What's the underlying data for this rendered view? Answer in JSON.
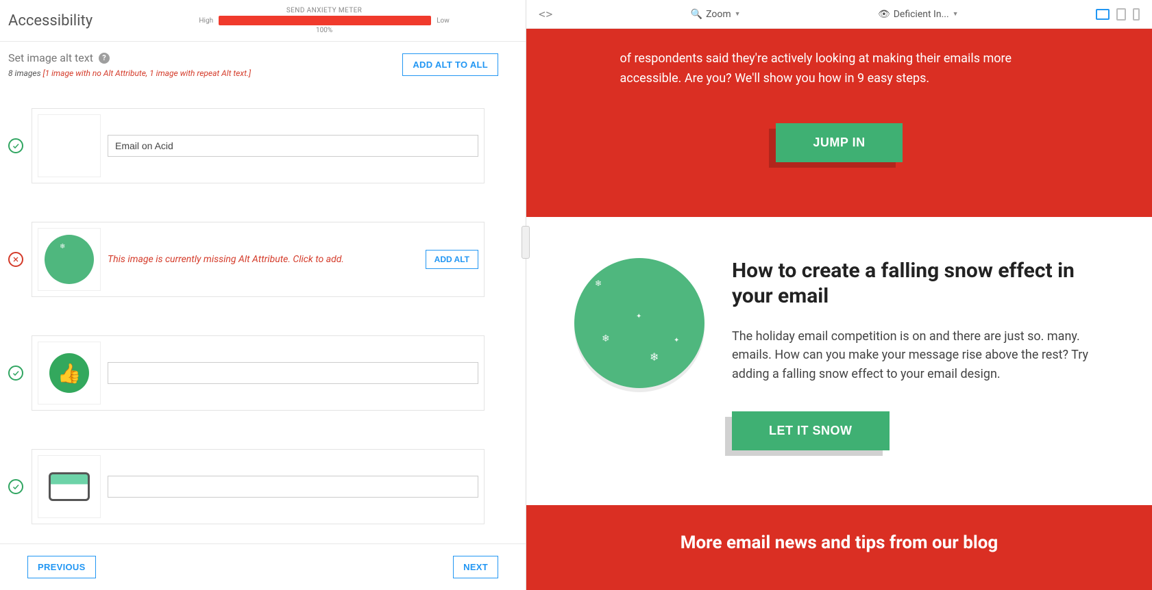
{
  "header": {
    "title": "Accessibility",
    "meter_label": "SEND ANXIETY METER",
    "meter_high": "High",
    "meter_low": "Low",
    "meter_pct": "100%"
  },
  "subhead": {
    "title": "Set image alt text",
    "count_text": "8 images",
    "warn_text": "[1 image with no Alt Attribute, 1 image with repeat Alt text.]",
    "add_all": "ADD ALT TO ALL"
  },
  "rows": {
    "r1_value": "Email on Acid",
    "r2_msg": "This image is currently missing Alt Attribute. Click to add.",
    "r2_btn": "ADD ALT",
    "r3_value": "",
    "r4_value": ""
  },
  "nav": {
    "prev": "PREVIOUS",
    "next": "NEXT"
  },
  "toolbar": {
    "zoom": "Zoom",
    "deficient": "Deficient In..."
  },
  "email": {
    "hero_p": "of respondents said they're actively looking at making their emails more accessible. Are you? We'll show you how in 9 easy steps.",
    "hero_cta": "JUMP IN",
    "sect_h2": "How to create a falling snow effect in your email",
    "sect_p": "The holiday email competition is on and there are just so. many. emails. How can you make your message rise above the rest? Try adding a falling snow effect to your email design.",
    "sect_cta": "LET IT SNOW",
    "footer_h3": "More email news and tips from our blog"
  }
}
